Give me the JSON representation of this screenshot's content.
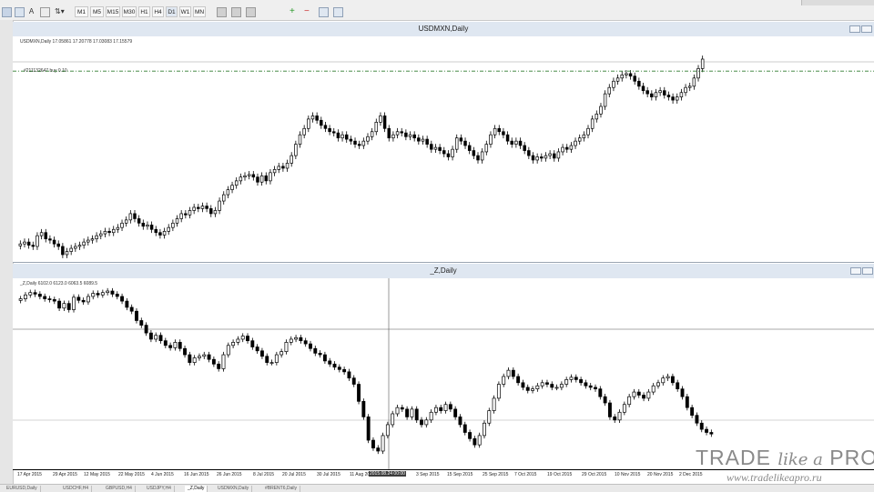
{
  "toolbar": {
    "buttons": [
      "M1",
      "M5",
      "M15",
      "M30",
      "H1",
      "H4",
      "D1",
      "W1",
      "MN"
    ]
  },
  "top_window": {
    "title": "USDMXN,Daily",
    "info": "USDMXN,Daily  17.05861 17.20778 17.03083 17.15579",
    "order_label": "#211132647 buy 0.10"
  },
  "bottom_window": {
    "title": "_Z,Daily",
    "info": "_Z,Daily  6102.0 6123.0 6063.5 6089.5"
  },
  "date_axis": [
    "17 Apr 2015",
    "29 Apr 2015",
    "12 May 2015",
    "22 May 2015",
    "4 Jun 2015",
    "16 Jun 2015",
    "26 Jun 2015",
    "8 Jul 2015",
    "20 Jul 2015",
    "30 Jul 2015",
    "11 Aug 2015",
    "2015.08.24 00:00",
    "3 Sep 2015",
    "15 Sep 2015",
    "25 Sep 2015",
    "7 Oct 2015",
    "19 Oct 2015",
    "29 Oct 2015",
    "10 Nov 2015",
    "20 Nov 2015",
    "2 Dec 2015"
  ],
  "tabs": [
    "EURUSD,Daily",
    "USDCHF,H4",
    "GBPUSD,H4",
    "USDJPY,H4",
    "_Z,Daily",
    "USDMXN,Daily",
    "#BRENT6,Daily"
  ],
  "active_tab": 4,
  "watermark": {
    "brand_trade": "TRADE",
    "brand_like": "like a",
    "brand_pro": "PRO",
    "url": "www.tradelikeapro.ru"
  },
  "chart_data": [
    {
      "type": "candlestick",
      "title": "USDMXN,Daily",
      "close": [
        15.22,
        15.25,
        15.2,
        15.18,
        15.35,
        15.4,
        15.3,
        15.28,
        15.22,
        15.18,
        15.05,
        15.1,
        15.15,
        15.18,
        15.2,
        15.25,
        15.28,
        15.3,
        15.35,
        15.38,
        15.42,
        15.4,
        15.45,
        15.48,
        15.55,
        15.6,
        15.7,
        15.62,
        15.55,
        15.5,
        15.52,
        15.45,
        15.4,
        15.36,
        15.42,
        15.48,
        15.55,
        15.62,
        15.7,
        15.68,
        15.75,
        15.8,
        15.78,
        15.82,
        15.78,
        15.7,
        15.75,
        15.9,
        16.0,
        16.08,
        16.15,
        16.22,
        16.28,
        16.3,
        16.32,
        16.28,
        16.2,
        16.3,
        16.22,
        16.35,
        16.4,
        16.45,
        16.42,
        16.5,
        16.62,
        16.8,
        16.95,
        17.05,
        17.2,
        17.25,
        17.18,
        17.1,
        17.05,
        17.0,
        16.98,
        16.9,
        16.95,
        16.88,
        16.85,
        16.8,
        16.78,
        16.85,
        16.92,
        17.0,
        17.15,
        17.25,
        17.05,
        16.9,
        16.95,
        17.0,
        16.98,
        16.92,
        16.95,
        16.9,
        16.85,
        16.88,
        16.8,
        16.72,
        16.75,
        16.7,
        16.65,
        16.6,
        16.72,
        16.9,
        16.85,
        16.78,
        16.7,
        16.62,
        16.55,
        16.68,
        16.8,
        16.95,
        17.05,
        17.0,
        16.95,
        16.85,
        16.8,
        16.85,
        16.78,
        16.7,
        16.62,
        16.55,
        16.6,
        16.58,
        16.62,
        16.65,
        16.58,
        16.68,
        16.75,
        16.72,
        16.78,
        16.85,
        16.9,
        16.95,
        17.05,
        17.2,
        17.28,
        17.4,
        17.6,
        17.7,
        17.8,
        17.85,
        17.9,
        17.92,
        17.88,
        17.8,
        17.72,
        17.65,
        17.6,
        17.55,
        17.62,
        17.65,
        17.58,
        17.55,
        17.5,
        17.55,
        17.62,
        17.7,
        17.72,
        17.85,
        18.0,
        18.15
      ],
      "series": [
        {
          "name": "Buy order",
          "value": 17.96
        }
      ]
    },
    {
      "type": "candlestick",
      "title": "_Z,Daily",
      "close": [
        6960,
        6985,
        7000,
        6990,
        6975,
        6960,
        6955,
        6945,
        6900,
        6930,
        6890,
        6970,
        6950,
        6940,
        6975,
        6995,
        6985,
        7000,
        7010,
        6990,
        6975,
        6945,
        6905,
        6880,
        6820,
        6790,
        6740,
        6700,
        6725,
        6690,
        6660,
        6645,
        6680,
        6640,
        6600,
        6550,
        6580,
        6590,
        6600,
        6570,
        6540,
        6510,
        6600,
        6660,
        6680,
        6700,
        6720,
        6690,
        6650,
        6625,
        6590,
        6550,
        6550,
        6600,
        6620,
        6680,
        6700,
        6710,
        6690,
        6670,
        6640,
        6610,
        6600,
        6560,
        6540,
        6520,
        6505,
        6490,
        6450,
        6410,
        6300,
        6200,
        6050,
        6000,
        5980,
        6080,
        6150,
        6220,
        6260,
        6250,
        6200,
        6250,
        6180,
        6150,
        6180,
        6230,
        6260,
        6240,
        6280,
        6250,
        6200,
        6150,
        6100,
        6060,
        6020,
        6080,
        6160,
        6240,
        6320,
        6410,
        6460,
        6500,
        6460,
        6420,
        6390,
        6370,
        6380,
        6400,
        6420,
        6410,
        6390,
        6390,
        6410,
        6440,
        6455,
        6440,
        6420,
        6400,
        6390,
        6380,
        6330,
        6290,
        6200,
        6180,
        6230,
        6280,
        6330,
        6360,
        6340,
        6320,
        6360,
        6400,
        6420,
        6450,
        6460,
        6420,
        6380,
        6330,
        6260,
        6210,
        6160,
        6120,
        6100,
        6090
      ],
      "crosshair_label": "2015.08.24 00:00"
    }
  ]
}
